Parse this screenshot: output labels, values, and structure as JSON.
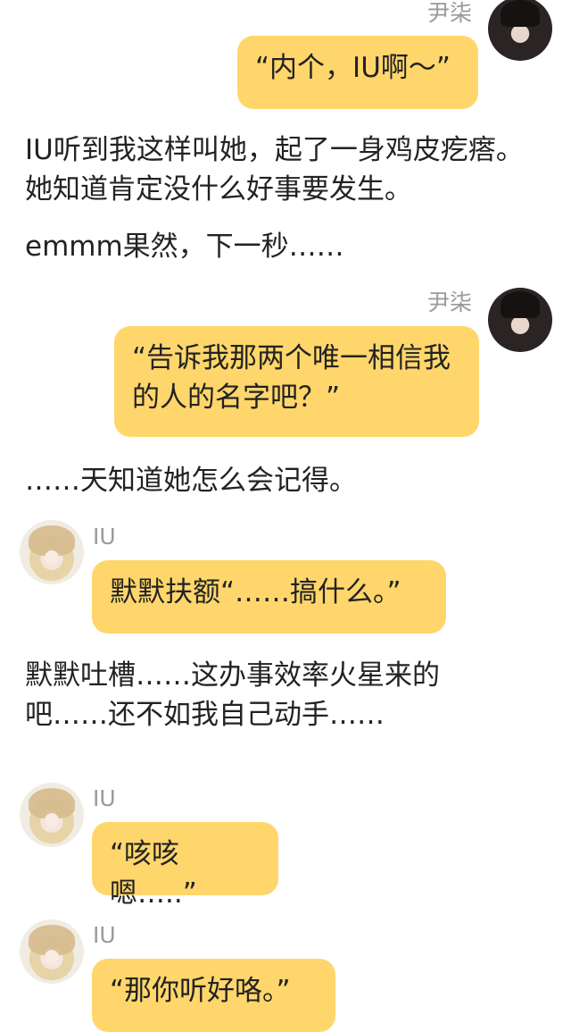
{
  "chat": [
    {
      "speaker": "尹柒",
      "bubble_text": "“内个，IU啊～”"
    },
    {
      "narration": [
        "IU听到我这样叫她，起了一身鸡皮疙瘩。她知道肯定没什么好事要发生。",
        "emmm果然，下一秒……"
      ]
    },
    {
      "speaker": "尹柒",
      "bubble_text": "“告诉我那两个唯一相信我的人的名字吧？”"
    },
    {
      "narration": [
        "……天知道她怎么会记得。"
      ]
    },
    {
      "speaker": "IU",
      "bubble_text": "默默扶额“……搞什么。”"
    },
    {
      "narration": [
        "默默吐槽……这办事效率火星来的吧……还不如我自己动手……"
      ]
    },
    {
      "speaker": "IU",
      "bubble_text": "“咳咳嗯…..”"
    },
    {
      "speaker": "IU",
      "bubble_text": "“那你听好咯。”"
    }
  ]
}
